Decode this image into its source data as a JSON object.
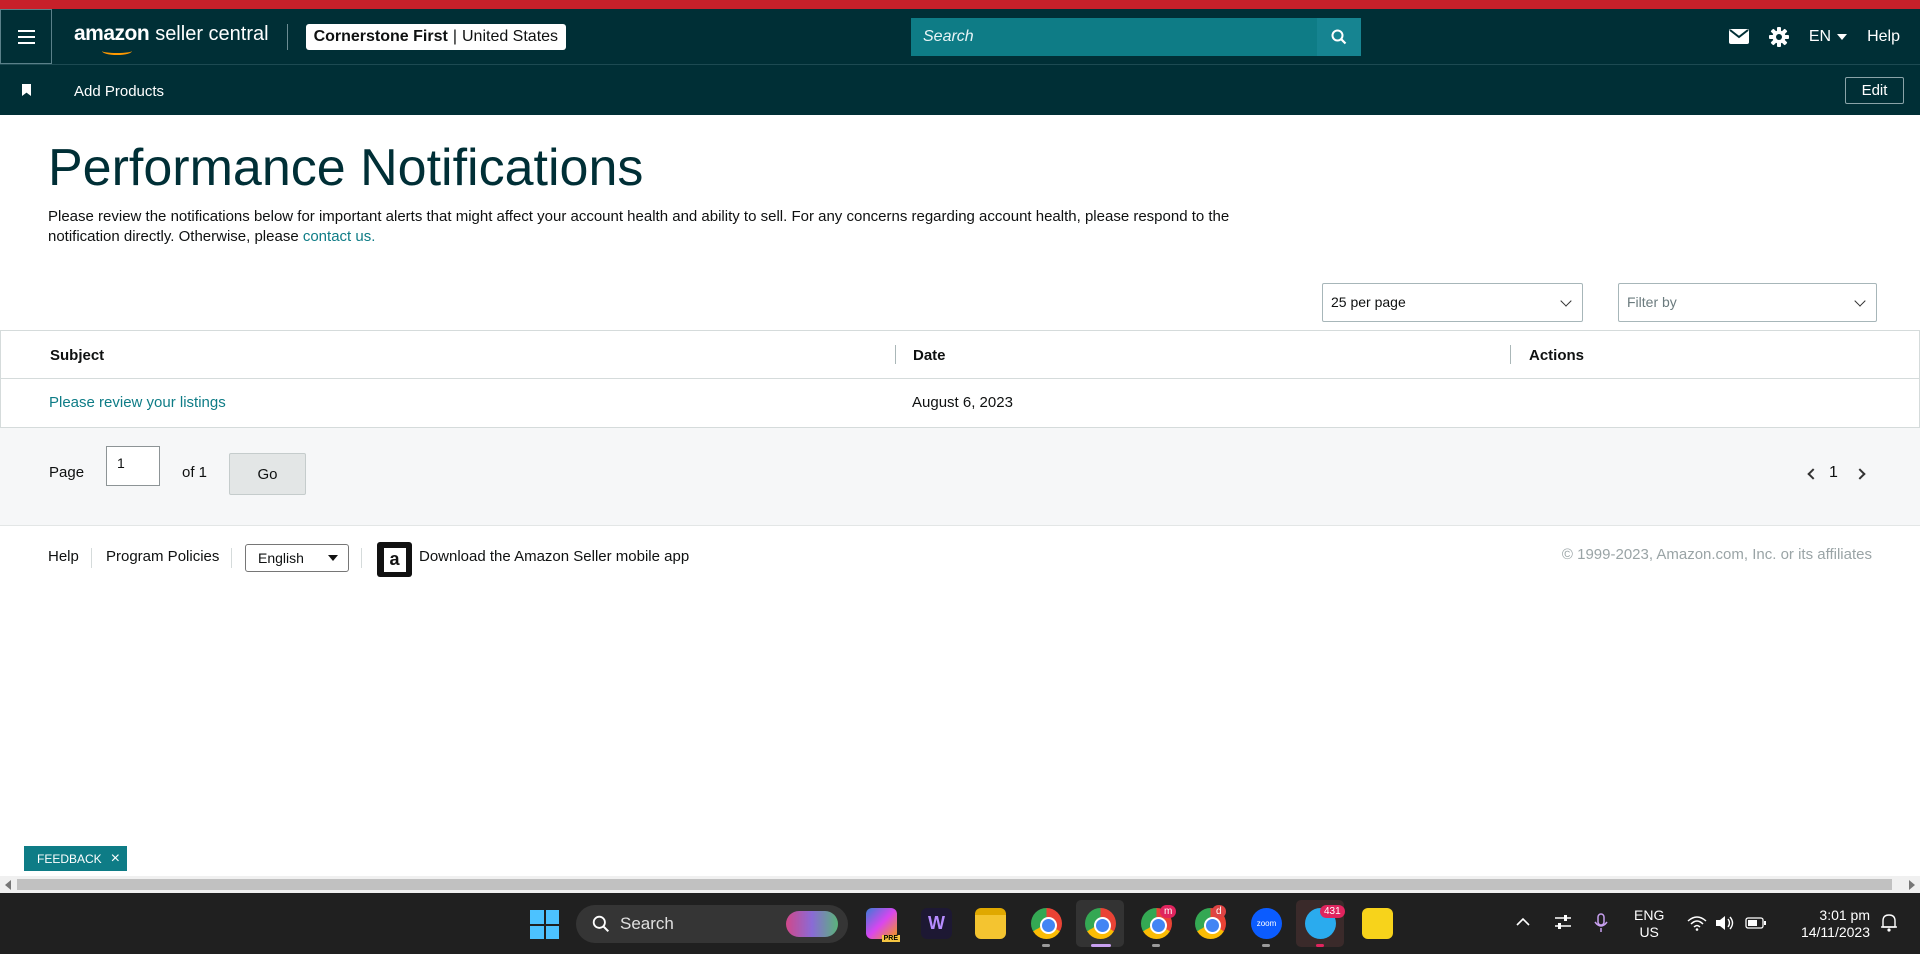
{
  "header": {
    "logo_brand": "amazon",
    "logo_product": "seller central",
    "store_name": "Cornerstone First",
    "store_separator": "|",
    "store_region": "United States",
    "search_placeholder": "Search",
    "language": "EN",
    "help": "Help"
  },
  "subnav": {
    "add_products": "Add Products",
    "edit": "Edit"
  },
  "page": {
    "title": "Performance Notifications",
    "description_1": "Please review the notifications below for important alerts that might affect your account health and ability to sell. For any concerns regarding account health, please respond to the notification directly. Otherwise, please ",
    "description_link": "contact us.",
    "per_page": "25 per page",
    "filter_placeholder": "Filter by"
  },
  "table": {
    "columns": [
      "Subject",
      "Date",
      "Actions"
    ],
    "rows": [
      {
        "subject": "Please review your listings",
        "date": "August 6, 2023",
        "actions": ""
      }
    ]
  },
  "pagination": {
    "page_label": "Page",
    "current_page": "1",
    "of_label": "of 1",
    "go": "Go",
    "page_number": "1"
  },
  "footer": {
    "help": "Help",
    "program_policies": "Program Policies",
    "language_select": "English",
    "app_icon_letter": "a",
    "download_app": "Download the Amazon Seller mobile app",
    "copyright": "© 1999-2023, Amazon.com, Inc. or its affiliates"
  },
  "feedback": {
    "label": "FEEDBACK",
    "close": "×"
  },
  "taskbar": {
    "search": "Search",
    "telegram_badge": "431",
    "chrome2_badge": "m",
    "chrome3_badge": "d",
    "lang_line1": "ENG",
    "lang_line2": "US",
    "time": "3:01 pm",
    "date": "14/11/2023",
    "zoom_label": "zoom",
    "w_app_letter": "W",
    "copilot_tag": "PRE"
  },
  "colors": {
    "nav_bg": "#002f36",
    "accent_teal": "#0e7c86",
    "top_bar_red": "#c7202a"
  }
}
